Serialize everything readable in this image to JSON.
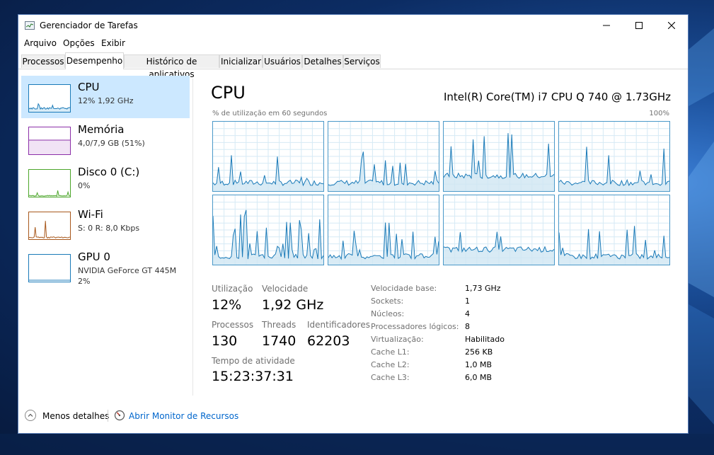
{
  "window": {
    "title": "Gerenciador de Tarefas"
  },
  "menu": [
    "Arquivo",
    "Opções",
    "Exibir"
  ],
  "tabs": [
    "Processos",
    "Desempenho",
    "Histórico de aplicativos",
    "Inicializar",
    "Usuários",
    "Detalhes",
    "Serviços"
  ],
  "active_tab": "Desempenho",
  "sidebar": [
    {
      "title": "CPU",
      "sub1": "12% 1,92 GHz",
      "color": "#1a7ab8"
    },
    {
      "title": "Memória",
      "sub1": "4,0/7,9 GB (51%)",
      "color": "#8b2fa8"
    },
    {
      "title": "Disco 0 (C:)",
      "sub1": "0%",
      "color": "#4ca62a"
    },
    {
      "title": "Wi-Fi",
      "sub1": "S: 0 R: 8,0 Kbps",
      "color": "#a8581c"
    },
    {
      "title": "GPU 0",
      "sub1": "NVIDIA GeForce GT 445M",
      "sub2": "2%",
      "color": "#1a7ab8"
    }
  ],
  "main": {
    "title": "CPU",
    "model": "Intel(R) Core(TM) i7 CPU Q 740 @ 1.73GHz",
    "graph_caption": "% de utilização em 60 segundos",
    "graph_max": "100%"
  },
  "stats": {
    "util_label": "Utilização",
    "util_value": "12%",
    "speed_label": "Velocidade",
    "speed_value": "1,92 GHz",
    "proc_label": "Processos",
    "proc_value": "130",
    "threads_label": "Threads",
    "threads_value": "1740",
    "handles_label": "Identificadores",
    "handles_value": "62203",
    "uptime_label": "Tempo de atividade",
    "uptime_value": "15:23:37:31"
  },
  "info": [
    {
      "label": "Velocidade base:",
      "value": "1,73 GHz"
    },
    {
      "label": "Sockets:",
      "value": "1"
    },
    {
      "label": "Núcleos:",
      "value": "4"
    },
    {
      "label": "Processadores lógicos:",
      "value": "8"
    },
    {
      "label": "Virtualização:",
      "value": "Habilitado"
    },
    {
      "label": "Cache L1:",
      "value": "256 KB"
    },
    {
      "label": "Cache L2:",
      "value": "1,0 MB"
    },
    {
      "label": "Cache L3:",
      "value": "6,0 MB"
    }
  ],
  "footer": {
    "fewer_details": "Menos detalhes",
    "resource_monitor": "Abrir Monitor de Recursos"
  },
  "colors": {
    "accent": "#1a7ab8",
    "graph_border": "#4a98c8",
    "link": "#0066cc",
    "selected": "#cce8ff"
  }
}
